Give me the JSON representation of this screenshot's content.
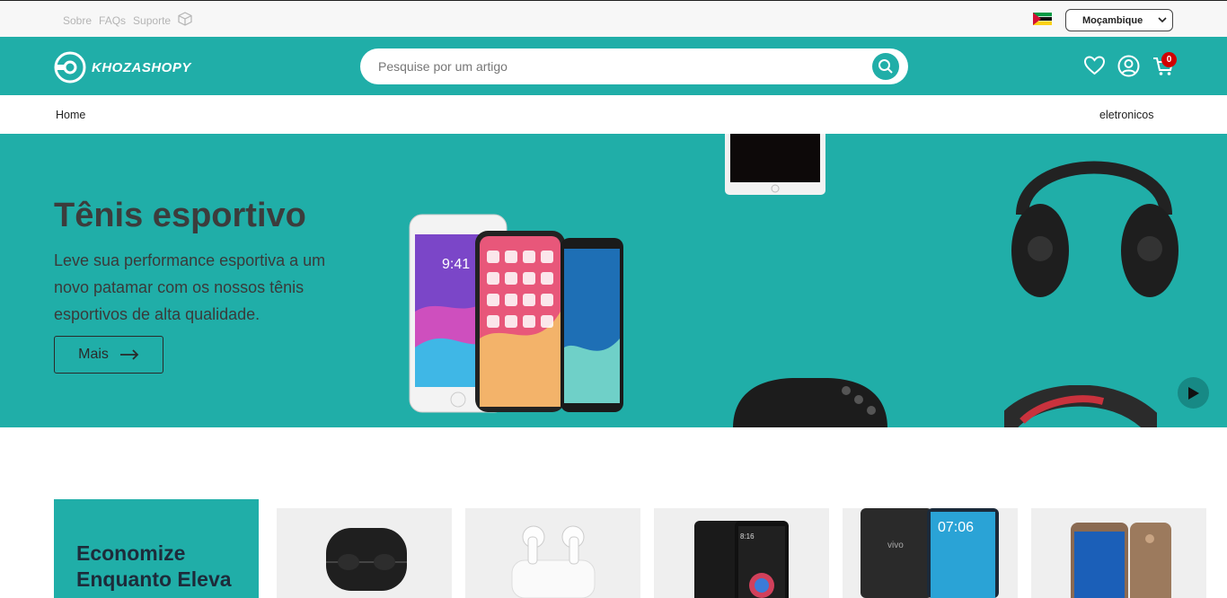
{
  "topbar": {
    "links": [
      "Sobre",
      "FAQs",
      "Suporte"
    ],
    "country_select": "Moçambique"
  },
  "header": {
    "logo_text": "KHOZASHOPY",
    "search_placeholder": "Pesquise por um artigo",
    "cart_count": "0",
    "accent_color": "#20aea8"
  },
  "nav": {
    "home": "Home",
    "category": "eletronicos"
  },
  "hero": {
    "title": "Tênis esportivo",
    "text": "Leve sua performance esportiva a um novo patamar com os nossos tênis esportivos de alta qualidade.",
    "button_label": "Mais",
    "phone_time": "9:41"
  },
  "promo": {
    "title": "Economize Enquanto Eleva"
  },
  "products": [
    {
      "name": "black-earbuds-case",
      "screen_text": ""
    },
    {
      "name": "white-airpods",
      "screen_text": ""
    },
    {
      "name": "black-smartphone-pair",
      "screen_text": "8:16"
    },
    {
      "name": "vivo-phone",
      "screen_text": "07:06",
      "brand": "vivo"
    },
    {
      "name": "bronze-phone",
      "screen_text": ""
    }
  ]
}
